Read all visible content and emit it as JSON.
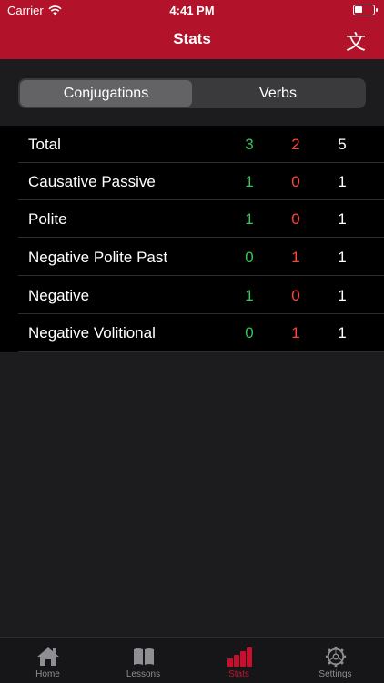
{
  "status_bar": {
    "carrier": "Carrier",
    "time": "4:41 PM"
  },
  "nav": {
    "title": "Stats",
    "kanji_button": "文"
  },
  "segmented": {
    "options": [
      {
        "label": "Conjugations",
        "selected": true
      },
      {
        "label": "Verbs",
        "selected": false
      }
    ]
  },
  "stats": {
    "rows": [
      {
        "label": "Total",
        "correct": "3",
        "wrong": "2",
        "total": "5"
      },
      {
        "label": "Causative Passive",
        "correct": "1",
        "wrong": "0",
        "total": "1"
      },
      {
        "label": "Polite",
        "correct": "1",
        "wrong": "0",
        "total": "1"
      },
      {
        "label": "Negative Polite Past",
        "correct": "0",
        "wrong": "1",
        "total": "1"
      },
      {
        "label": "Negative",
        "correct": "1",
        "wrong": "0",
        "total": "1"
      },
      {
        "label": "Negative Volitional",
        "correct": "0",
        "wrong": "1",
        "total": "1"
      }
    ]
  },
  "tabbar": {
    "tabs": [
      {
        "label": "Home",
        "icon": "home-icon"
      },
      {
        "label": "Lessons",
        "icon": "book-icon"
      },
      {
        "label": "Stats",
        "icon": "bar-chart-icon",
        "active": true
      },
      {
        "label": "Settings",
        "icon": "gear-icon"
      }
    ]
  },
  "colors": {
    "accent": "#b3132a",
    "correct": "#34c759",
    "wrong": "#ff453a",
    "background": "#1c1c1e"
  }
}
